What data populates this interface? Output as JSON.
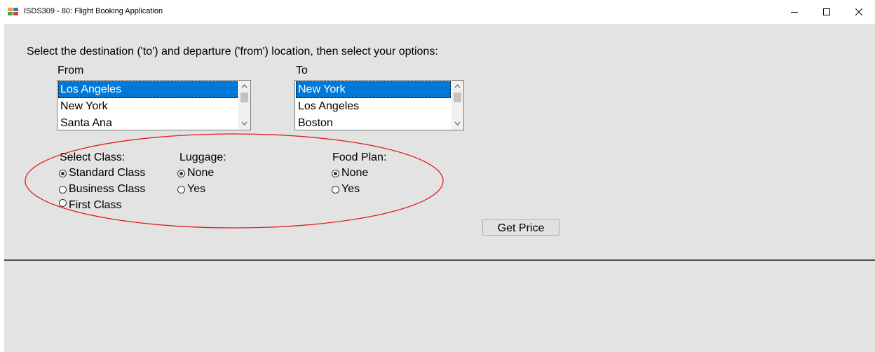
{
  "window": {
    "title": "ISDS309 - 80: Flight Booking Application",
    "icon": "app-icon",
    "controls": [
      "minimize-icon",
      "maximize-icon",
      "close-icon"
    ]
  },
  "instruction": "Select the destination ('to') and departure ('from') location, then select your options:",
  "from_list": {
    "label": "From",
    "items": [
      "Los Angeles",
      "New York",
      "Santa Ana"
    ],
    "selected": "Los Angeles"
  },
  "to_list": {
    "label": "To",
    "items": [
      "New York",
      "Los Angeles",
      "Boston"
    ],
    "selected": "New York"
  },
  "class_group": {
    "label": "Select Class:",
    "options": [
      "Standard Class",
      "Business Class",
      "First Class"
    ],
    "selected": "Standard Class"
  },
  "luggage_group": {
    "label": "Luggage:",
    "options": [
      "None",
      "Yes"
    ],
    "selected": "None"
  },
  "food_group": {
    "label": "Food Plan:",
    "options": [
      "None",
      "Yes"
    ],
    "selected": "None"
  },
  "get_price_button": "Get Price",
  "colors": {
    "selection": "#0078d7",
    "form_background": "#e3e3e3",
    "annotation_ellipse": "#e02020"
  }
}
